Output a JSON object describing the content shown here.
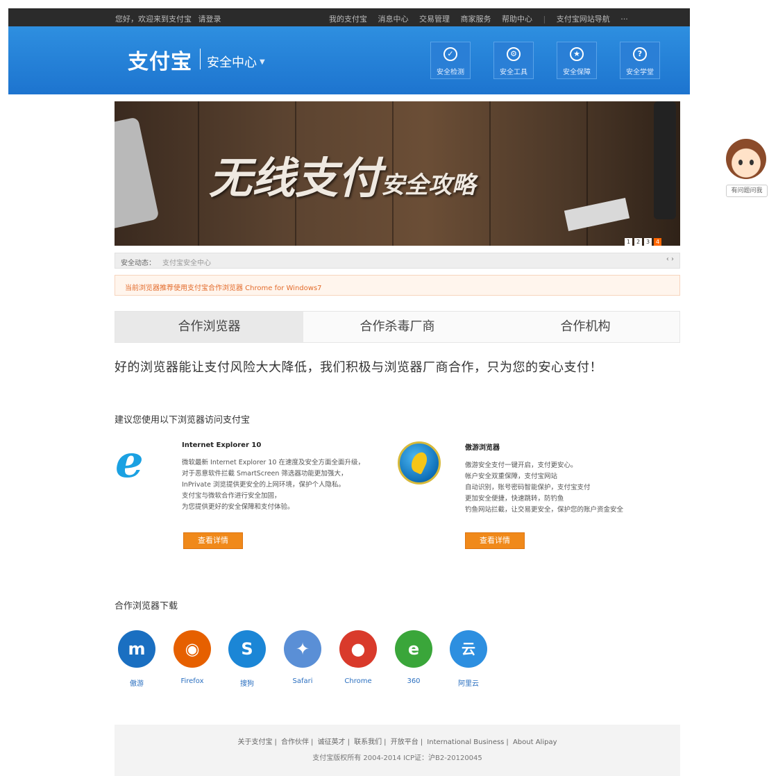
{
  "topbar": {
    "welcome": "您好，欢迎来到支付宝",
    "login": "请登录",
    "nav": [
      "我的支付宝",
      "消息中心",
      "交易管理",
      "商家服务",
      "帮助中心"
    ],
    "right": "支付宝网站导航",
    "more": "···"
  },
  "header": {
    "logo": "支付宝",
    "section": "安全中心",
    "caret": "▼",
    "buttons": [
      {
        "icon": "shield-check-icon",
        "glyph": "✓",
        "label": "安全检测"
      },
      {
        "icon": "tools-icon",
        "glyph": "⚙",
        "label": "安全工具"
      },
      {
        "icon": "star-shield-icon",
        "glyph": "★",
        "label": "安全保障"
      },
      {
        "icon": "question-icon",
        "glyph": "?",
        "label": "安全学堂"
      }
    ]
  },
  "banner": {
    "title_main": "无线支付",
    "title_sub": "安全攻略",
    "slides": [
      "1",
      "2",
      "3",
      "4"
    ],
    "active_slide": "4"
  },
  "notice": {
    "label": "安全动态：",
    "text": "支付宝安全中心",
    "arrows": "‹ ›"
  },
  "tip": {
    "text": "当前浏览器推荐使用支付宝合作浏览器 Chrome for Windows7"
  },
  "tabs": {
    "items": [
      "合作浏览器",
      "合作杀毒厂商",
      "合作机构"
    ],
    "active": "合作浏览器"
  },
  "headline": "好的浏览器能让支付风险大大降低，我们积极与浏览器厂商合作，只为您的安心支付！",
  "recommend": {
    "heading": "建议您使用以下浏览器访问支付宝",
    "items": [
      {
        "name": "Internet Explorer 10",
        "desc": [
          "微软最新 Internet Explorer 10 在速度及安全方面全面升级，",
          "对于恶意软件拦截 SmartScreen 筛选器功能更加强大，",
          "InPrivate 浏览提供更安全的上网环境，保护个人隐私。",
          "支付宝与微软合作进行安全加固，",
          "为您提供更好的安全保障和支付体验。"
        ],
        "button": "查看详情"
      },
      {
        "name": "傲游浏览器",
        "desc": [
          "傲游安全支付一键开启，支付更安心。",
          "帐户安全双重保障，支付宝网站",
          "自动识别，账号密码智能保护，支付宝支付",
          "更加安全便捷，快速跳转，防钓鱼",
          "钓鱼网站拦截，让交易更安全，保护您的账户资金安全"
        ],
        "button": "查看详情"
      }
    ]
  },
  "downloads": {
    "heading": "合作浏览器下载",
    "items": [
      {
        "label": "傲游",
        "icon": "maxthon-icon",
        "glyph": "m",
        "color": "#1a6fc1"
      },
      {
        "label": "Firefox",
        "icon": "firefox-icon",
        "glyph": "◉",
        "color": "#e66000"
      },
      {
        "label": "搜狗",
        "icon": "sogou-icon",
        "glyph": "S",
        "color": "#1b86d6"
      },
      {
        "label": "Safari",
        "icon": "safari-icon",
        "glyph": "✦",
        "color": "#5a8fd6"
      },
      {
        "label": "Chrome",
        "icon": "chrome-icon",
        "glyph": "●",
        "color": "#d93a2b"
      },
      {
        "label": "360",
        "icon": "ie360-icon",
        "glyph": "e",
        "color": "#3aa63a"
      },
      {
        "label": "阿里云",
        "icon": "aliyun-icon",
        "glyph": "云",
        "color": "#2d8fe0"
      }
    ]
  },
  "footer": {
    "links": [
      "关于支付宝",
      "合作伙伴",
      "诚征英才",
      "联系我们",
      "开放平台",
      "International Business",
      "About Alipay"
    ],
    "copyright": "支付宝版权所有 2004-2014 ICP证：沪B2-20120045"
  },
  "service": {
    "badge": "有问题问我"
  }
}
